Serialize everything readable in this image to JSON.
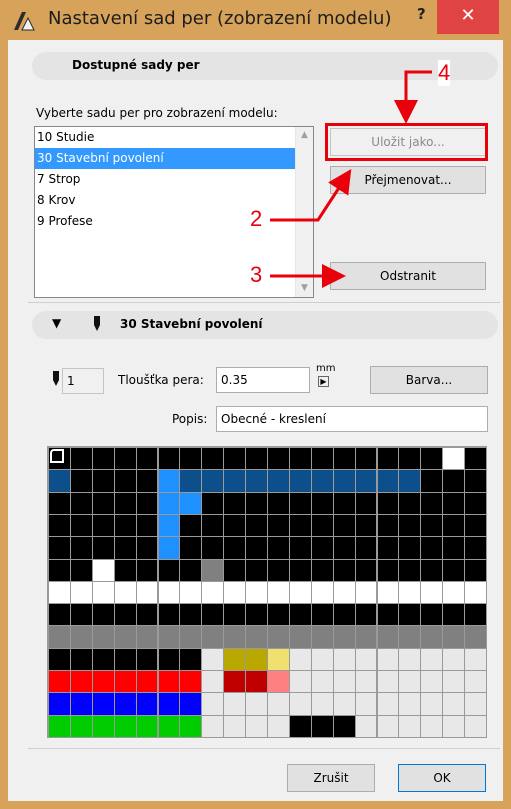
{
  "window": {
    "title": "Nastavení sad per (zobrazení modelu)",
    "help_label": "?",
    "close_label": "✕"
  },
  "available_sets": {
    "section_title": "Dostupné sady per",
    "prompt": "Vyberte sadu per pro zobrazení modelu:",
    "items": [
      "10 Studie",
      "30 Stavební povolení",
      "7 Strop",
      "8 Krov",
      "9 Profese"
    ],
    "selected_index": 1,
    "save_as_label": "Uložit jako...",
    "rename_label": "Přejmenovat...",
    "delete_label": "Odstranit"
  },
  "pen_set": {
    "collapse_glyph": "▼",
    "title": "30 Stavební povolení",
    "pen_number": "1",
    "thickness_label": "Tloušťka pera:",
    "thickness_value": "0.35",
    "unit": "mm",
    "color_button": "Barva...",
    "description_label": "Popis:",
    "description_value": "Obecné - kreslení"
  },
  "pen_palette": {
    "columns": 20,
    "rows": 12,
    "colors": {
      "K": "#000000",
      "W": "#ffffff",
      "N": "#0d4f8b",
      "B": "#1e90ff",
      "G": "#808080",
      "L": "#e8e8e8",
      "R": "#ff0000",
      "D": "#c00000",
      "P": "#ff8080",
      "U": "#0000ff",
      "V": "#00cc00",
      "O": "#b8a800",
      "Y": "#f0e070"
    },
    "rows_data": [
      "KKKKKKKKKKKKKKKKKKWK",
      "NKKKKBNNNNNNNNNNNKKK",
      "KKKKKBBKKKKKKKKKKKKK",
      "KKKKKBKKKKKKKKKKKKKK",
      "KKKKKBKKKKKKKKKKKKKK",
      "KKWKKKKGKKKKKKKKKKKK",
      "WWWWWWWWWWWWWWWWWWWW",
      "KKKKKKKKKKKKKKKKKKKK",
      "GGGGGGGGGGGGGGGGGGGG",
      "KKKKKKKLOOYLLLLLLLLL",
      "RRRRRRRLDDPLLLLLLLLL",
      "UUUUUUULLLLLLLLLLLLL",
      "VVVVVVVLLLLKKKLLLLLL"
    ]
  },
  "footer": {
    "cancel_label": "Zrušit",
    "ok_label": "OK"
  },
  "annotations": {
    "callout_2": "2",
    "callout_3": "3",
    "callout_4": "4",
    "accent": "#e8000b"
  }
}
